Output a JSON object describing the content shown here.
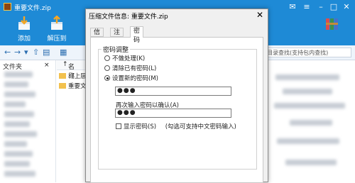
{
  "window": {
    "title": "重要文件.zip"
  },
  "toolbar": {
    "add_label": "添加",
    "extract_label": "解压到"
  },
  "navbar": {
    "search_placeholder": "目录查找(支持包内查找)"
  },
  "left_pane": {
    "header": "文件夹"
  },
  "file_list": {
    "column_name": "名称",
    "rows": [
      "..(上层目录)",
      "重要文件"
    ]
  },
  "dialog": {
    "title": "压缩文件信息: 重要文件.zip",
    "tabs": [
      "信息",
      "注释",
      "密码"
    ],
    "active_tab": "密码",
    "group_title": "密码调整",
    "options": {
      "no_process": "不做处理(K)",
      "clear_password": "清除已有密码(L)",
      "set_new_password": "设置新的密码(M)"
    },
    "selected_option": "set_new_password",
    "password_value": "●●●",
    "confirm_label": "再次输入密码以确认(A)",
    "confirm_value": "●●●",
    "show_password_label": "显示密码(S)",
    "show_password_note": "(勾选可支持中文密码输入)",
    "show_password_checked": false
  },
  "colors": {
    "accent": "#1e8ad6",
    "folder": "#f2c14e"
  }
}
